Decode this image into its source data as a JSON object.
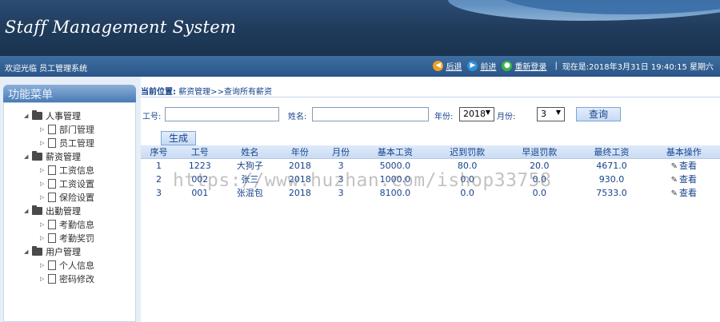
{
  "banner": {
    "title": "Staff Management System"
  },
  "infobar": {
    "welcome": "欢迎光临 员工管理系统",
    "back_label": "后退",
    "forward_label": "前进",
    "relogin_label": "重新登录",
    "datetime": "现在是:2018年3月31日 19:40:15 星期六"
  },
  "sidebar": {
    "title": "功能菜单",
    "groups": [
      {
        "label": "人事管理",
        "items": [
          "部门管理",
          "员工管理"
        ]
      },
      {
        "label": "薪资管理",
        "items": [
          "工资信息",
          "工资设置",
          "保险设置"
        ]
      },
      {
        "label": "出勤管理",
        "items": [
          "考勤信息",
          "考勤奖罚"
        ]
      },
      {
        "label": "用户管理",
        "items": [
          "个人信息",
          "密码修改"
        ]
      }
    ]
  },
  "location": {
    "prefix": "当前位置:",
    "path": "薪资管理>>查询所有薪资"
  },
  "search": {
    "id_label": "工号:",
    "id_value": "",
    "name_label": "姓名:",
    "name_value": "",
    "year_label": "年份:",
    "year_value": "2018",
    "month_label": "月份:",
    "month_value": "3",
    "query_label": "查询"
  },
  "generate_label": "生成",
  "table": {
    "headers": [
      "序号",
      "工号",
      "姓名",
      "年份",
      "月份",
      "基本工资",
      "迟到罚款",
      "早退罚款",
      "最终工资",
      "基本操作"
    ],
    "rows": [
      [
        "1",
        "1223",
        "大狗子",
        "2018",
        "3",
        "5000.0",
        "80.0",
        "20.0",
        "4671.0",
        "查看"
      ],
      [
        "2",
        "002",
        "张三",
        "2018",
        "3",
        "1000.0",
        "0.0",
        "0.0",
        "930.0",
        "查看"
      ],
      [
        "3",
        "001",
        "张混包",
        "2018",
        "3",
        "8100.0",
        "0.0",
        "0.0",
        "7533.0",
        "查看"
      ]
    ]
  },
  "watermark": "https://www.huzhan.com/ishop33758",
  "icons": {
    "back": "back-arrow-icon",
    "forward": "forward-arrow-icon",
    "relogin": "relogin-icon",
    "folder": "folder-icon",
    "document": "document-icon",
    "pencil": "pencil-icon"
  },
  "colors": {
    "banner": "#1f3a5a",
    "infobar": "#2b5588",
    "text": "#15428b"
  }
}
